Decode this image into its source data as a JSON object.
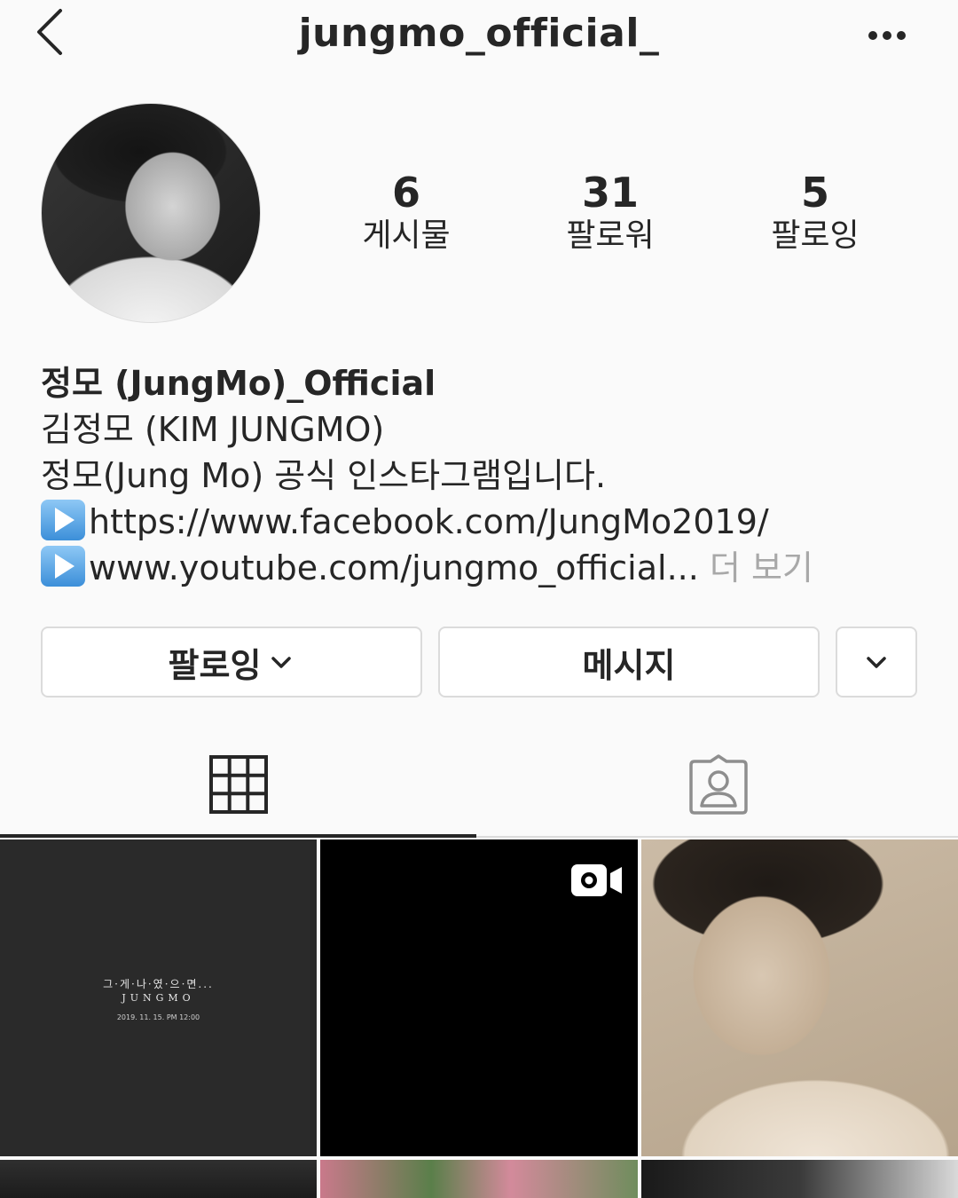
{
  "header": {
    "username": "jungmo_official_"
  },
  "stats": [
    {
      "value": "6",
      "label": "게시물"
    },
    {
      "value": "31",
      "label": "팔로워"
    },
    {
      "value": "5",
      "label": "팔로잉"
    }
  ],
  "bio": {
    "name": "정모 (JungMo)_Official",
    "line1": "김정모 (KIM JUNGMO)",
    "line2": "정모(Jung Mo) 공식 인스타그램입니다.",
    "link1": "https://www.facebook.com/JungMo2019/",
    "link2": "www.youtube.com/jungmo_official...",
    "more": "더 보기"
  },
  "buttons": {
    "follow": "팔로잉",
    "message": "메시지"
  },
  "posts": {
    "post1": {
      "title": "그·게·나·였·으·면...",
      "artist": "JUNGMO",
      "date": "2019. 11. 15. PM 12:00"
    }
  },
  "icons": {
    "back": "chevron-left-icon",
    "more": "ellipsis-icon",
    "grid": "grid-icon",
    "tagged": "tagged-person-icon",
    "video": "video-camera-icon",
    "play": "play-button-icon"
  },
  "colors": {
    "background": "#fafafa",
    "text": "#262626",
    "muted": "#a8a8a8",
    "border": "#dbdbdb",
    "play_icon": "#3c8fd9"
  }
}
